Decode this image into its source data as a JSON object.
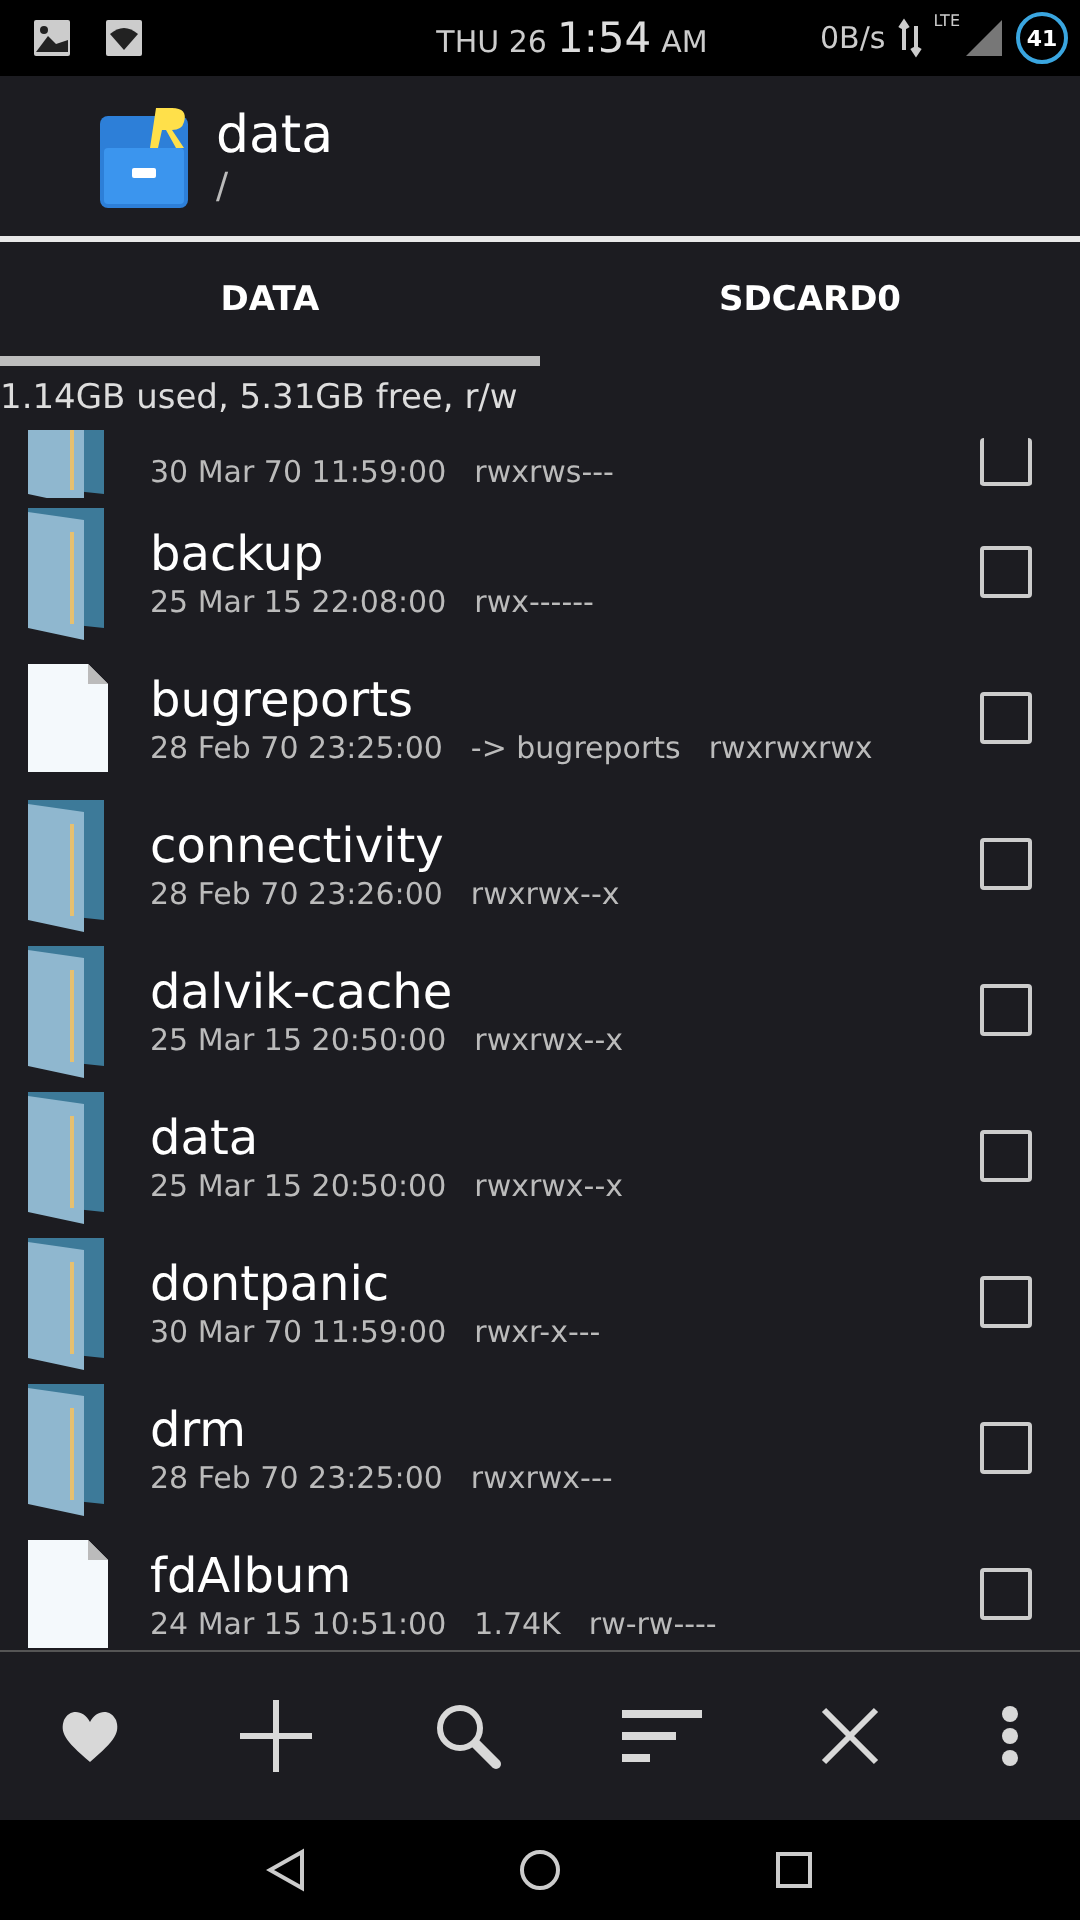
{
  "status_bar": {
    "day": "THU 26",
    "time": "1:54",
    "ampm": "AM",
    "speed": "0B/s",
    "network": "LTE",
    "battery": "41"
  },
  "header": {
    "title": "data",
    "path": "/"
  },
  "tabs": [
    {
      "label": "DATA",
      "selected": true
    },
    {
      "label": "SDCARD0",
      "selected": false
    }
  ],
  "storage": "1.14GB used, 5.31GB free, r/w",
  "rows": [
    {
      "kind": "folder",
      "date": "30 Mar 70 11:59:00",
      "perms": "rwxrws---",
      "checked": false
    },
    {
      "kind": "folder",
      "name": "backup",
      "date": "25 Mar 15 22:08:00",
      "perms": "rwx------",
      "checked": false
    },
    {
      "kind": "file",
      "name": "bugreports",
      "date": "28 Feb 70 23:25:00",
      "info": "-> bugreports",
      "perms": "rwxrwxrwx",
      "checked": false
    },
    {
      "kind": "folder",
      "name": "connectivity",
      "date": "28 Feb 70 23:26:00",
      "perms": "rwxrwx--x",
      "checked": false
    },
    {
      "kind": "folder",
      "name": "dalvik-cache",
      "date": "25 Mar 15 20:50:00",
      "perms": "rwxrwx--x",
      "checked": false
    },
    {
      "kind": "folder",
      "name": "data",
      "date": "25 Mar 15 20:50:00",
      "perms": "rwxrwx--x",
      "checked": false
    },
    {
      "kind": "folder",
      "name": "dontpanic",
      "date": "30 Mar 70 11:59:00",
      "perms": "rwxr-x---",
      "checked": false
    },
    {
      "kind": "folder",
      "name": "drm",
      "date": "28 Feb 70 23:25:00",
      "perms": "rwxrwx---",
      "checked": false
    },
    {
      "kind": "file",
      "name": "fdAlbum",
      "date": "24 Mar 15 10:51:00",
      "info": "1.74K",
      "perms": "rw-rw----",
      "checked": false
    }
  ]
}
